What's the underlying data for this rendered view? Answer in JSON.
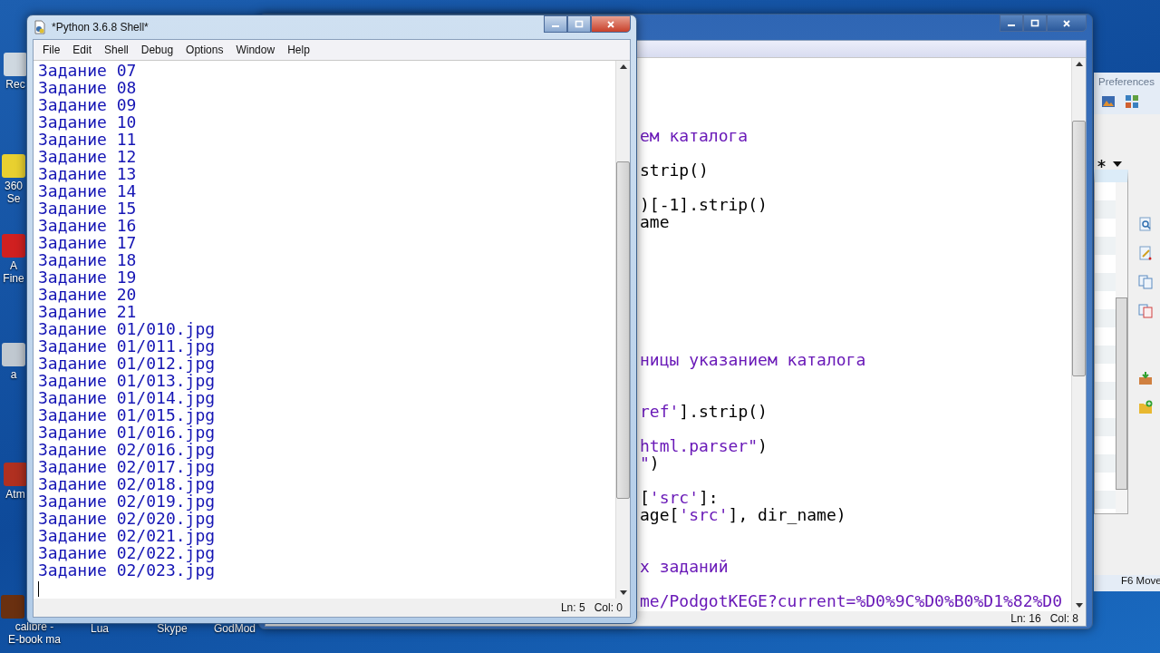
{
  "desktop_icons": [
    {
      "lines": [
        "Rec"
      ]
    },
    {
      "lines": [
        "360",
        "Se"
      ]
    },
    {
      "lines": [
        "A",
        "Fine"
      ]
    },
    {
      "lines": [
        "a"
      ]
    },
    {
      "lines": [
        "Atm"
      ]
    },
    {
      "lines": [
        "calibre -",
        "E-book ma"
      ]
    },
    {
      "lines": [
        "Lua"
      ]
    },
    {
      "lines": [
        "Skype"
      ]
    },
    {
      "lines": [
        "GodMod"
      ]
    }
  ],
  "editor": {
    "lines": [
      {
        "kind": "blank"
      },
      {
        "kind": "blank"
      },
      {
        "kind": "blank"
      },
      {
        "kind": "blank"
      },
      {
        "kind": "code",
        "segments": [
          {
            "kind": "string",
            "text": "ем каталога"
          }
        ]
      },
      {
        "kind": "blank"
      },
      {
        "kind": "code",
        "segments": [
          {
            "kind": "plain",
            "text": "strip()"
          }
        ]
      },
      {
        "kind": "blank"
      },
      {
        "kind": "code",
        "segments": [
          {
            "kind": "plain",
            "text": ")[-1].strip()"
          }
        ]
      },
      {
        "kind": "code",
        "segments": [
          {
            "kind": "plain",
            "text": "ame"
          }
        ]
      },
      {
        "kind": "blank"
      },
      {
        "kind": "blank"
      },
      {
        "kind": "blank"
      },
      {
        "kind": "blank"
      },
      {
        "kind": "blank"
      },
      {
        "kind": "blank"
      },
      {
        "kind": "blank"
      },
      {
        "kind": "code",
        "segments": [
          {
            "kind": "string",
            "text": "ницы указанием каталога"
          }
        ]
      },
      {
        "kind": "blank"
      },
      {
        "kind": "blank"
      },
      {
        "kind": "code",
        "segments": [
          {
            "kind": "string",
            "text": "ref'"
          },
          {
            "kind": "plain",
            "text": "].strip()"
          }
        ]
      },
      {
        "kind": "blank"
      },
      {
        "kind": "code",
        "segments": [
          {
            "kind": "string",
            "text": "html.parser\""
          },
          {
            "kind": "plain",
            "text": ")"
          }
        ]
      },
      {
        "kind": "code",
        "segments": [
          {
            "kind": "string",
            "text": "\""
          },
          {
            "kind": "plain",
            "text": ")"
          }
        ]
      },
      {
        "kind": "blank"
      },
      {
        "kind": "code",
        "segments": [
          {
            "kind": "plain",
            "text": "["
          },
          {
            "kind": "string",
            "text": "'src'"
          },
          {
            "kind": "plain",
            "text": "]:"
          }
        ]
      },
      {
        "kind": "code",
        "segments": [
          {
            "kind": "plain",
            "text": "age["
          },
          {
            "kind": "string",
            "text": "'src'"
          },
          {
            "kind": "plain",
            "text": "], dir_name)"
          }
        ]
      },
      {
        "kind": "blank"
      },
      {
        "kind": "blank"
      },
      {
        "kind": "code",
        "segments": [
          {
            "kind": "string",
            "text": "х заданий"
          }
        ]
      },
      {
        "kind": "blank"
      },
      {
        "kind": "code",
        "segments": [
          {
            "kind": "string",
            "text": "me/PodgotKEGE?current=%D0%9C%D0%B0%D1%82%D0"
          }
        ]
      }
    ],
    "status": {
      "line": "Ln: 16",
      "column": "Col: 8"
    }
  },
  "preferences": {
    "title": "Preferences",
    "footer": "F6 Move"
  },
  "shell": {
    "title": "*Python 3.6.8 Shell*",
    "menu": [
      "File",
      "Edit",
      "Shell",
      "Debug",
      "Options",
      "Window",
      "Help"
    ],
    "output": [
      "Задание 07",
      "Задание 08",
      "Задание 09",
      "Задание 10",
      "Задание 11",
      "Задание 12",
      "Задание 13",
      "Задание 14",
      "Задание 15",
      "Задание 16",
      "Задание 17",
      "Задание 18",
      "Задание 19",
      "Задание 20",
      "Задание 21",
      "Задание 01/010.jpg",
      "Задание 01/011.jpg",
      "Задание 01/012.jpg",
      "Задание 01/013.jpg",
      "Задание 01/014.jpg",
      "Задание 01/015.jpg",
      "Задание 01/016.jpg",
      "Задание 02/016.jpg",
      "Задание 02/017.jpg",
      "Задание 02/018.jpg",
      "Задание 02/019.jpg",
      "Задание 02/020.jpg",
      "Задание 02/021.jpg",
      "Задание 02/022.jpg",
      "Задание 02/023.jpg"
    ],
    "status": {
      "line": "Ln: 5",
      "column": "Col: 0"
    }
  }
}
